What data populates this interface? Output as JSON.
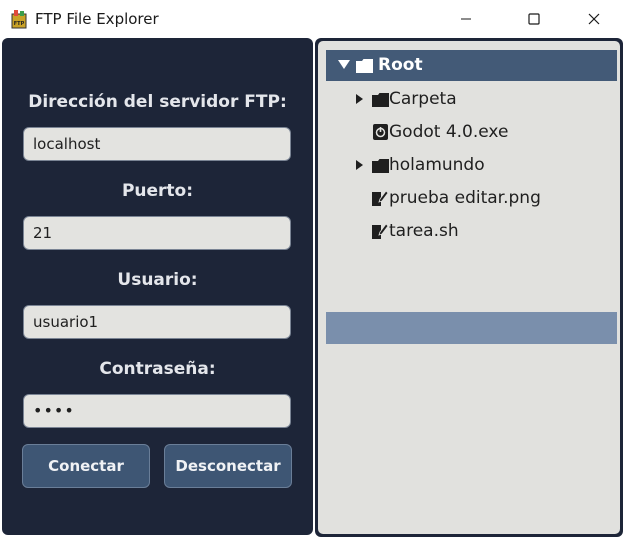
{
  "window": {
    "title": "FTP File Explorer",
    "icon": "ftp-app-icon",
    "controls": [
      "minimize-icon",
      "maximize-icon",
      "close-icon"
    ]
  },
  "form": {
    "server_label": "Dirección del servidor FTP:",
    "server_value": "localhost",
    "port_label": "Puerto:",
    "port_value": "21",
    "user_label": "Usuario:",
    "user_value": "usuario1",
    "password_label": "Contraseña:",
    "password_value": "••••",
    "connect_label": "Conectar",
    "disconnect_label": "Desconectar"
  },
  "tree": {
    "root": {
      "label": "Root",
      "icon": "folder-icon",
      "expanded": true
    },
    "items": [
      {
        "label": "Carpeta",
        "type": "folder",
        "icon": "folder-icon",
        "expandable": true
      },
      {
        "label": "Godot 4.0.exe",
        "type": "file",
        "icon": "executable-icon",
        "expandable": false
      },
      {
        "label": "holamundo",
        "type": "folder",
        "icon": "folder-icon",
        "expandable": true
      },
      {
        "label": "prueba editar.png",
        "type": "file",
        "icon": "file-edit-icon",
        "expandable": false
      },
      {
        "label": "tarea.sh",
        "type": "file",
        "icon": "file-edit-icon",
        "expandable": false
      }
    ]
  },
  "colors": {
    "panel_bg": "#1d2538",
    "tree_bg": "#e1e1de",
    "root_highlight": "#435a77",
    "selection_bar": "#7a8fac",
    "button_bg": "#3e5674"
  }
}
